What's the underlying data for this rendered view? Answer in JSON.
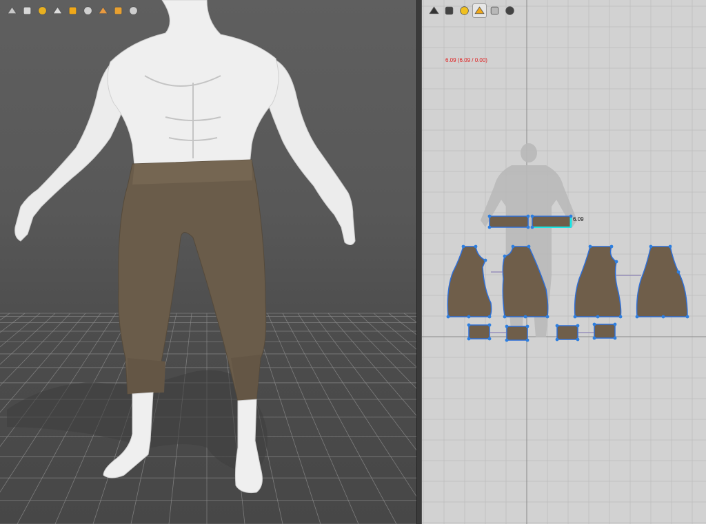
{
  "viewport_3d": {
    "toolbar": [
      {
        "name": "avatar-display-icon",
        "color": "#c8c8c8"
      },
      {
        "name": "garment-display-icon",
        "color": "#d8d8d8"
      },
      {
        "name": "fabric-swatch-icon",
        "color": "#e8b020"
      },
      {
        "name": "avatar-pose-icon",
        "color": "#dcdcdc"
      },
      {
        "name": "texture-display-icon",
        "color": "#f0a818"
      },
      {
        "name": "simulation-quality-icon",
        "color": "#d0d0d0"
      },
      {
        "name": "avatar-skin-icon",
        "color": "#e89a40"
      },
      {
        "name": "render-sphere-icon",
        "color": "#e8a030"
      },
      {
        "name": "export-icon",
        "color": "#cfcfcf"
      }
    ],
    "colors": {
      "skin": "#eeeeee",
      "fabric": "#6a5c4a",
      "grid": "#8a8a8a"
    }
  },
  "viewport_2d": {
    "toolbar": [
      {
        "name": "pattern-edit-icon",
        "color": "#333333",
        "active": false
      },
      {
        "name": "garment-2d-icon",
        "color": "#444444",
        "active": false
      },
      {
        "name": "info-icon",
        "color": "#f0c020",
        "active": false
      },
      {
        "name": "texture-2d-icon",
        "color": "#f0a818",
        "active": true
      },
      {
        "name": "fold-display-icon",
        "color": "#b8b8b8",
        "active": false
      },
      {
        "name": "export-2d-icon",
        "color": "#444444",
        "active": false
      }
    ],
    "measurement_readout": "6.09 (6.09 / 0.00)",
    "measurement_tag": "6.09",
    "colors": {
      "pattern_fill": "#6f5e4a",
      "outline_blue": "#2f6fd6",
      "point": "#2d7fe0",
      "highlight": "#19e6e6",
      "grid": "#bdbdbd",
      "axis": "#8a8a8a",
      "readout": "#e02020"
    }
  }
}
